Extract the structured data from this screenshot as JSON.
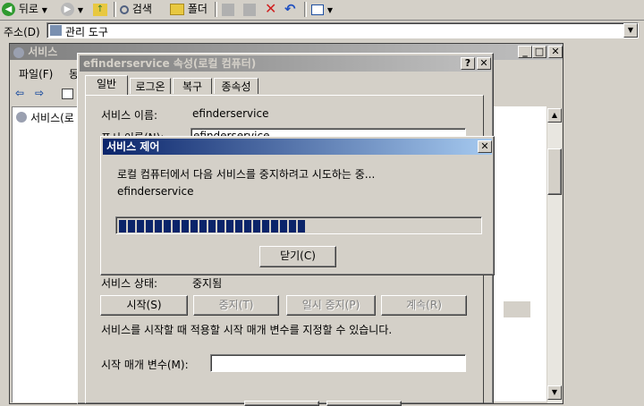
{
  "toolbar": {
    "back_label": "뒤로",
    "search_label": "검색",
    "folders_label": "폴더"
  },
  "address": {
    "label": "주소(D)",
    "value": "관리 도구"
  },
  "services_window": {
    "title": "서비스",
    "menu_file": "파일(F)",
    "menu_partial": "동",
    "tree_item": "서비스(로"
  },
  "properties_dialog": {
    "title": "efinderservice 속성(로컬 컴퓨터)",
    "help_button": "?",
    "close_button": "X",
    "tabs": [
      "일반",
      "로그온",
      "복구",
      "종속성"
    ],
    "service_name_label": "서비스 이름:",
    "service_name_value": "efinderservice",
    "display_name_label": "표시 이름(N):",
    "display_name_value": "efinderservice",
    "service_status_label": "서비스 상태:",
    "service_status_value": "중지됨",
    "start_button": "시작(S)",
    "stop_button": "중지(T)",
    "pause_button": "일시 중지(P)",
    "resume_button": "계속(R)",
    "start_params_desc": "서비스를 시작할 때 적용할 시작 매개 변수를 지정할 수 있습니다.",
    "start_params_label": "시작 매개 변수(M):",
    "start_params_value": ""
  },
  "service_control": {
    "title": "서비스 제어",
    "close_button": "X",
    "message": "로컬 컴퓨터에서 다음 서비스를 중지하려고 시도하는 중...",
    "service_name": "efinderservice",
    "progress": 0.52,
    "close_label": "닫기(C)"
  },
  "colors": {
    "face": "#d4d0c8",
    "active_title": "#0a246a",
    "progress": "#0a246a"
  }
}
